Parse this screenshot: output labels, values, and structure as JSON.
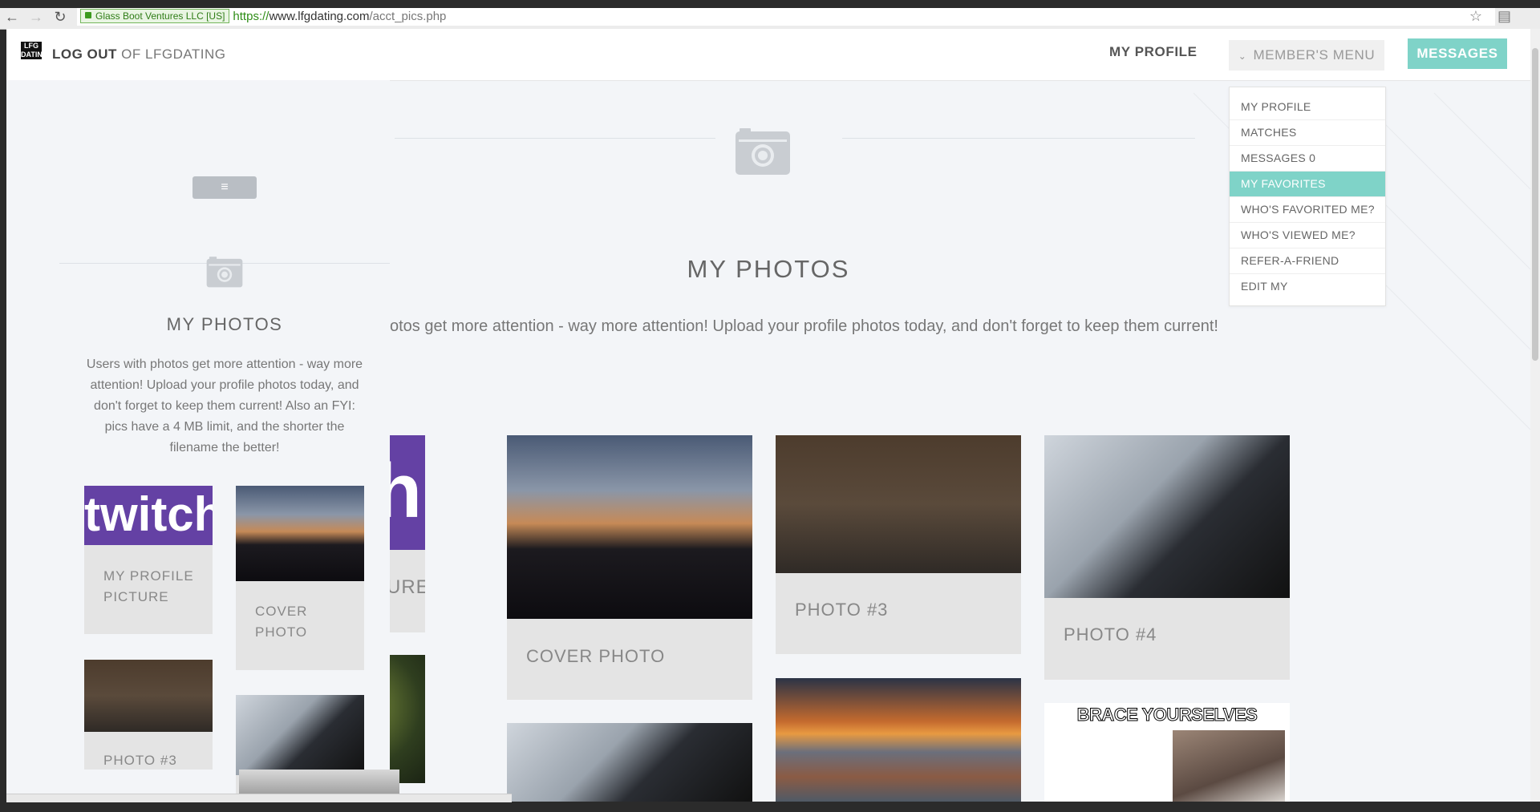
{
  "browser": {
    "ev_label": "Glass Boot Ventures LLC [US]",
    "url_scheme": "https://",
    "url_host": "www.lfgdating.com",
    "url_path": "/acct_pics.php",
    "back_icon": "back-arrow-icon",
    "forward_icon": "forward-arrow-icon",
    "reload_icon": "reload-icon"
  },
  "navbar": {
    "logo_text": "LFG DATING",
    "logout_bold": "LOG OUT",
    "logout_rest": " OF LFGDATING",
    "my_profile": "MY PROFILE",
    "members_menu": "MEMBER'S MENU",
    "messages": "MESSAGES",
    "accent": "#7fd3c8"
  },
  "dropdown": {
    "items": [
      "MY PROFILE",
      "MATCHES",
      "MESSAGES 0",
      "MY FAVORITES",
      "WHO'S FAVORITED ME?",
      "WHO'S VIEWED ME?",
      "REFER-A-FRIEND",
      "EDIT MY"
    ],
    "active": "MY FAVORITES"
  },
  "main": {
    "title": "MY PHOTOS",
    "description": "otos get more attention - way more attention! Upload your profile photos today, and don't forget to keep them current!"
  },
  "mini": {
    "toggle_icon": "menu-icon",
    "title": "MY PHOTOS",
    "description": "Users with photos get more attention - way more attention! Upload your profile photos today, and don't forget to keep them current! Also an FYI: pics have a 4 MB limit, and the shorter the filename the better!"
  },
  "cards": {
    "profile_picture": "MY PROFILE PICTURE",
    "cover_photo": "COVER PHOTO",
    "photo3": "PHOTO #3",
    "photo4": "PHOTO #4",
    "picture_partial": "CTURE",
    "twitch_text": "twitch",
    "twitch_partial": "ch",
    "meme_text": "BRACE YOURSELVES"
  }
}
